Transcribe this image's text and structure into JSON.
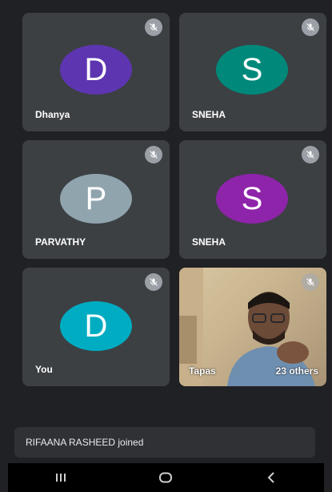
{
  "tiles": [
    {
      "name": "Dhanya",
      "initial": "D",
      "color": "#5e35b1"
    },
    {
      "name": "SNEHA",
      "initial": "S",
      "color": "#00897b"
    },
    {
      "name": "PARVATHY",
      "initial": "P",
      "color": "#90a4ae"
    },
    {
      "name": "SNEHA",
      "initial": "S",
      "color": "#8e24aa"
    },
    {
      "name": "You",
      "initial": "D",
      "color": "#00acc1"
    }
  ],
  "video_tile": {
    "name": "Tapas",
    "others": "23 others"
  },
  "toast": {
    "text": "RIFAANA RASHEED joined"
  },
  "icons": {
    "mute": "mic-off-icon",
    "recents": "recents-icon",
    "home": "home-icon",
    "back": "back-icon"
  }
}
